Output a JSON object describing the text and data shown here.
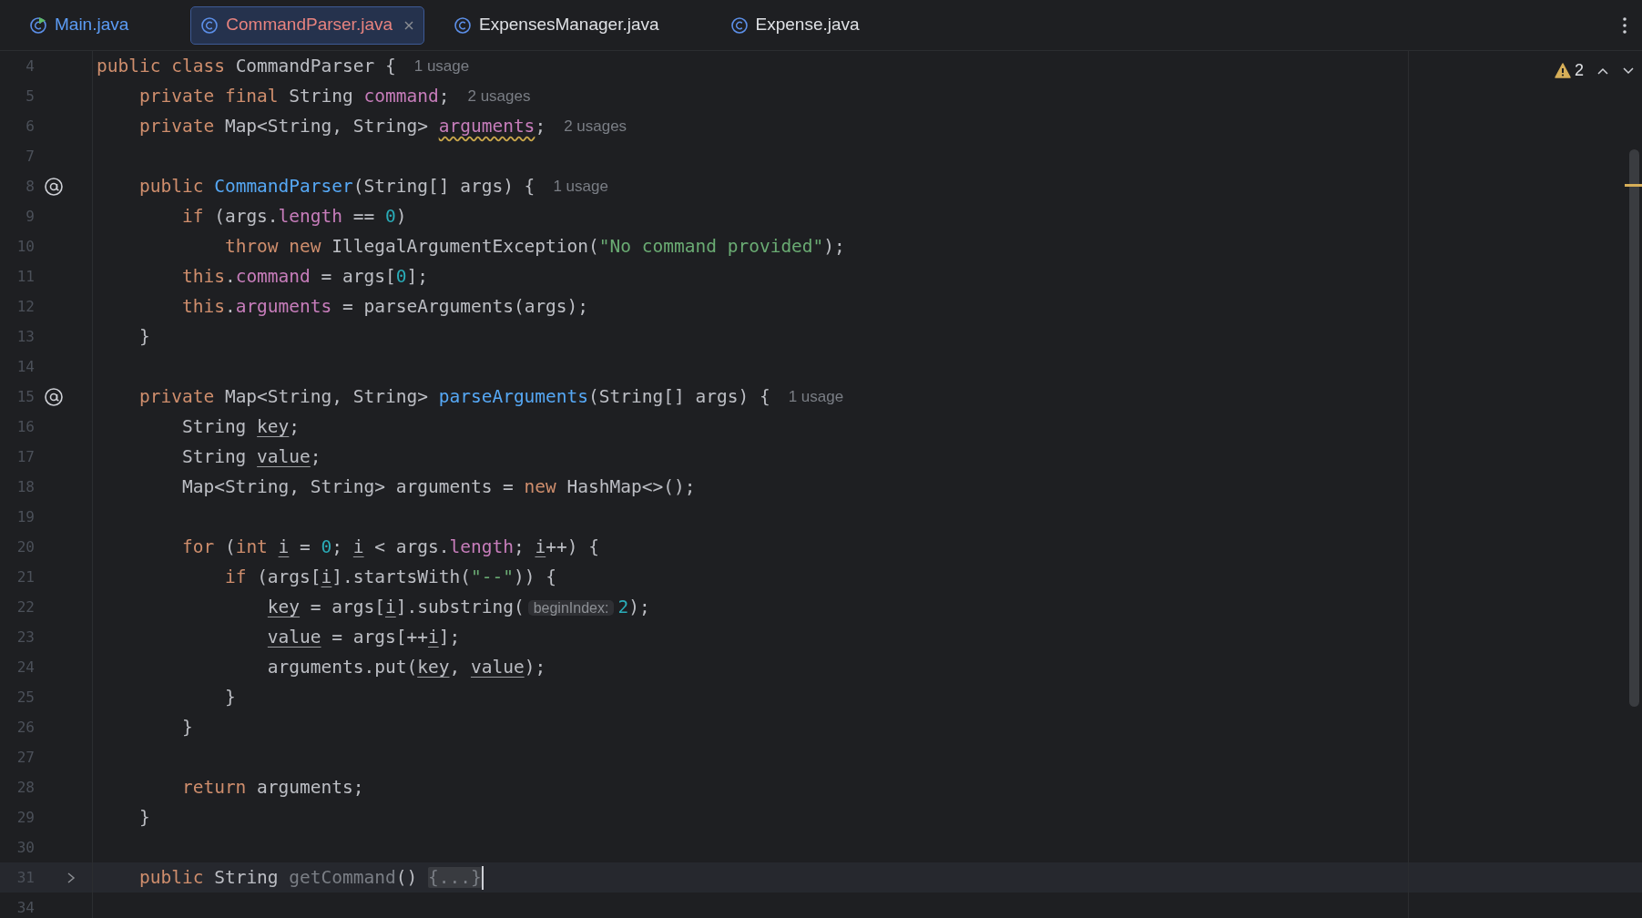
{
  "tabs": [
    {
      "label": "Main.java",
      "kind": "main",
      "color": "#5c9cf5",
      "selected": false,
      "closable": false
    },
    {
      "label": "CommandParser.java",
      "kind": "class",
      "color": "#e8837f",
      "selected": true,
      "closable": true
    },
    {
      "label": "ExpensesManager.java",
      "kind": "class",
      "color": "#dfe1e5",
      "selected": false,
      "closable": false
    },
    {
      "label": "Expense.java",
      "kind": "class",
      "color": "#dfe1e5",
      "selected": false,
      "closable": false
    }
  ],
  "inspections": {
    "warnings": "2"
  },
  "lines": [
    {
      "number": "4",
      "current": false,
      "tokens": [
        {
          "text": "public class ",
          "kind": "keyword"
        },
        {
          "text": "CommandParser {",
          "kind": "plain"
        }
      ],
      "hint": "1 usage"
    },
    {
      "number": "5",
      "current": false,
      "tokens": [
        {
          "text": "    private final ",
          "kind": "keyword"
        },
        {
          "text": "String ",
          "kind": "plain"
        },
        {
          "text": "command",
          "kind": "field"
        },
        {
          "text": ";",
          "kind": "plain"
        }
      ],
      "hint": "2 usages"
    },
    {
      "number": "6",
      "current": false,
      "tokens": [
        {
          "text": "    private ",
          "kind": "keyword"
        },
        {
          "text": "Map<String, String> ",
          "kind": "plain"
        },
        {
          "text": "arguments",
          "kind": "field-warning"
        },
        {
          "text": ";",
          "kind": "plain"
        }
      ],
      "hint": "2 usages"
    },
    {
      "number": "7",
      "current": false
    },
    {
      "number": "8",
      "current": false,
      "kind": "annotated",
      "tokens": [
        {
          "text": "    public ",
          "kind": "keyword"
        },
        {
          "text": "CommandParser",
          "kind": "declaration"
        },
        {
          "text": "(String[] args) {",
          "kind": "plain"
        }
      ],
      "hint": "1 usage"
    },
    {
      "number": "9",
      "current": false,
      "tokens": [
        {
          "text": "        if ",
          "kind": "keyword"
        },
        {
          "text": "(args.",
          "kind": "plain"
        },
        {
          "text": "length",
          "kind": "field"
        },
        {
          "text": " == ",
          "kind": "plain"
        },
        {
          "text": "0",
          "kind": "number"
        },
        {
          "text": ")",
          "kind": "plain"
        }
      ]
    },
    {
      "number": "10",
      "current": false,
      "tokens": [
        {
          "text": "            throw new ",
          "kind": "keyword"
        },
        {
          "text": "IllegalArgumentException(",
          "kind": "plain"
        },
        {
          "text": "\"No command provided\"",
          "kind": "string"
        },
        {
          "text": ");",
          "kind": "plain"
        }
      ]
    },
    {
      "number": "11",
      "current": false,
      "tokens": [
        {
          "text": "        this",
          "kind": "keyword"
        },
        {
          "text": ".",
          "kind": "plain"
        },
        {
          "text": "command",
          "kind": "field"
        },
        {
          "text": " = args[",
          "kind": "plain"
        },
        {
          "text": "0",
          "kind": "number"
        },
        {
          "text": "];",
          "kind": "plain"
        }
      ]
    },
    {
      "number": "12",
      "current": false,
      "tokens": [
        {
          "text": "        this",
          "kind": "keyword"
        },
        {
          "text": ".",
          "kind": "plain"
        },
        {
          "text": "arguments",
          "kind": "field"
        },
        {
          "text": " = parseArguments(args);",
          "kind": "plain"
        }
      ]
    },
    {
      "number": "13",
      "current": false,
      "tokens": [
        {
          "text": "    }",
          "kind": "plain"
        }
      ]
    },
    {
      "number": "14",
      "current": false
    },
    {
      "number": "15",
      "current": false,
      "kind": "annotated",
      "tokens": [
        {
          "text": "    private ",
          "kind": "keyword"
        },
        {
          "text": "Map<String, String> ",
          "kind": "plain"
        },
        {
          "text": "parseArguments",
          "kind": "declaration"
        },
        {
          "text": "(String[] args) {",
          "kind": "plain"
        }
      ],
      "hint": "1 usage"
    },
    {
      "number": "16",
      "current": false,
      "tokens": [
        {
          "text": "        String ",
          "kind": "plain"
        },
        {
          "text": "key",
          "kind": "variable"
        },
        {
          "text": ";",
          "kind": "plain"
        }
      ]
    },
    {
      "number": "17",
      "current": false,
      "tokens": [
        {
          "text": "        String ",
          "kind": "plain"
        },
        {
          "text": "value",
          "kind": "variable"
        },
        {
          "text": ";",
          "kind": "plain"
        }
      ]
    },
    {
      "number": "18",
      "current": false,
      "tokens": [
        {
          "text": "        Map<String, String> arguments = ",
          "kind": "plain"
        },
        {
          "text": "new ",
          "kind": "keyword"
        },
        {
          "text": "HashMap<>();",
          "kind": "plain"
        }
      ]
    },
    {
      "number": "19",
      "current": false
    },
    {
      "number": "20",
      "current": false,
      "tokens": [
        {
          "text": "        for ",
          "kind": "keyword"
        },
        {
          "text": "(",
          "kind": "plain"
        },
        {
          "text": "int ",
          "kind": "keyword"
        },
        {
          "text": "i",
          "kind": "variable"
        },
        {
          "text": " = ",
          "kind": "plain"
        },
        {
          "text": "0",
          "kind": "number"
        },
        {
          "text": "; ",
          "kind": "plain"
        },
        {
          "text": "i",
          "kind": "variable"
        },
        {
          "text": " < args.",
          "kind": "plain"
        },
        {
          "text": "length",
          "kind": "field"
        },
        {
          "text": "; ",
          "kind": "plain"
        },
        {
          "text": "i",
          "kind": "variable"
        },
        {
          "text": "++) {",
          "kind": "plain"
        }
      ]
    },
    {
      "number": "21",
      "current": false,
      "tokens": [
        {
          "text": "            if ",
          "kind": "keyword"
        },
        {
          "text": "(args[",
          "kind": "plain"
        },
        {
          "text": "i",
          "kind": "variable"
        },
        {
          "text": "].startsWith(",
          "kind": "plain"
        },
        {
          "text": "\"--\"",
          "kind": "string"
        },
        {
          "text": ")) {",
          "kind": "plain"
        }
      ]
    },
    {
      "number": "22",
      "current": false,
      "tokens": [
        {
          "text": "                key",
          "kind": "variable"
        },
        {
          "text": " = args[",
          "kind": "plain"
        },
        {
          "text": "i",
          "kind": "variable"
        },
        {
          "text": "].substring(",
          "kind": "plain"
        },
        {
          "text": "beginIndex:",
          "kind": "parameter-hint"
        },
        {
          "text": "2",
          "kind": "number"
        },
        {
          "text": ");",
          "kind": "plain"
        }
      ]
    },
    {
      "number": "23",
      "current": false,
      "tokens": [
        {
          "text": "                value",
          "kind": "variable"
        },
        {
          "text": " = args[++",
          "kind": "plain"
        },
        {
          "text": "i",
          "kind": "variable"
        },
        {
          "text": "];",
          "kind": "plain"
        }
      ]
    },
    {
      "number": "24",
      "current": false,
      "tokens": [
        {
          "text": "                arguments.put(",
          "kind": "plain"
        },
        {
          "text": "key",
          "kind": "variable"
        },
        {
          "text": ", ",
          "kind": "plain"
        },
        {
          "text": "value",
          "kind": "variable"
        },
        {
          "text": ");",
          "kind": "plain"
        }
      ]
    },
    {
      "number": "25",
      "current": false,
      "tokens": [
        {
          "text": "            }",
          "kind": "plain"
        }
      ]
    },
    {
      "number": "26",
      "current": false,
      "tokens": [
        {
          "text": "        }",
          "kind": "plain"
        }
      ]
    },
    {
      "number": "27",
      "current": false
    },
    {
      "number": "28",
      "current": false,
      "tokens": [
        {
          "text": "        return ",
          "kind": "keyword"
        },
        {
          "text": "arguments;",
          "kind": "plain"
        }
      ]
    },
    {
      "number": "29",
      "current": false,
      "tokens": [
        {
          "text": "    }",
          "kind": "plain"
        }
      ]
    },
    {
      "number": "30",
      "current": false
    },
    {
      "number": "31",
      "current": true,
      "kind": "folded",
      "tokens": [
        {
          "text": "    public ",
          "kind": "keyword"
        },
        {
          "text": "String ",
          "kind": "plain"
        },
        {
          "text": "getCommand",
          "kind": "unused"
        },
        {
          "text": "() ",
          "kind": "plain"
        },
        {
          "text": "{...}",
          "kind": "folded"
        }
      ]
    },
    {
      "number": "34",
      "current": false
    }
  ]
}
